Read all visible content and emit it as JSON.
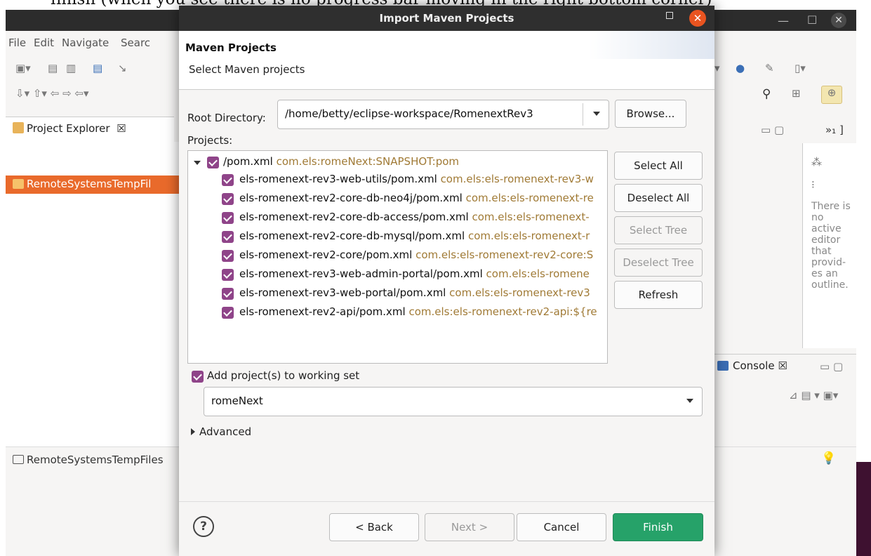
{
  "caption": "finish (when you see there is no progress bar moving in the right bottom corner)",
  "eclipse": {
    "menu": [
      "File",
      "Edit",
      "Navigate",
      "Searc"
    ],
    "project_explorer": {
      "tab_label": "Project Explorer  ☒",
      "selected_item": "RemoteSystemsTempFil"
    },
    "status_bar": {
      "label": "RemoteSystemsTempFiles"
    },
    "outline": {
      "message": "There is no active editor that provid- es an outline."
    },
    "console": {
      "tab_label": "Console ☒"
    }
  },
  "dialog": {
    "title": "Import Maven Projects",
    "header_title": "Maven Projects",
    "header_desc": "Select Maven projects",
    "root_dir_label": "Root Directory:",
    "root_dir_value": "/home/betty/eclipse-workspace/RomenextRev3",
    "browse_label": "Browse...",
    "projects_label": "Projects:",
    "root_project": {
      "name": "/pom.xml",
      "gav": "com.els:romeNext:SNAPSHOT:pom",
      "checked": true
    },
    "projects": [
      {
        "name": "els-romenext-rev3-web-utils/pom.xml",
        "gav": "com.els:els-romenext-rev3-w",
        "checked": true
      },
      {
        "name": "els-romenext-rev2-core-db-neo4j/pom.xml",
        "gav": "com.els:els-romenext-re",
        "checked": true
      },
      {
        "name": "els-romenext-rev2-core-db-access/pom.xml",
        "gav": "com.els:els-romenext-",
        "checked": true
      },
      {
        "name": "els-romenext-rev2-core-db-mysql/pom.xml",
        "gav": "com.els:els-romenext-r",
        "checked": true
      },
      {
        "name": "els-romenext-rev2-core/pom.xml",
        "gav": "com.els:els-romenext-rev2-core:S",
        "checked": true
      },
      {
        "name": "els-romenext-rev3-web-admin-portal/pom.xml",
        "gav": "com.els:els-romene",
        "checked": true
      },
      {
        "name": "els-romenext-rev3-web-portal/pom.xml",
        "gav": "com.els:els-romenext-rev3",
        "checked": true
      },
      {
        "name": "els-romenext-rev2-api/pom.xml",
        "gav": "com.els:els-romenext-rev2-api:${re",
        "checked": true
      }
    ],
    "side_buttons": {
      "select_all": "Select All",
      "deselect_all": "Deselect All",
      "select_tree": "Select Tree",
      "deselect_tree": "Deselect Tree",
      "refresh": "Refresh"
    },
    "working_set_label": "Add project(s) to working set",
    "working_set_checked": true,
    "working_set_value": "romeNext",
    "advanced_label": "Advanced",
    "footer": {
      "back": "< Back",
      "next": "Next >",
      "cancel": "Cancel",
      "finish": "Finish"
    },
    "colors": {
      "accent_checkbox": "#8f4489",
      "finish_button": "#26a269",
      "close_button": "#e95420",
      "gav_text": "#a07a35"
    }
  }
}
